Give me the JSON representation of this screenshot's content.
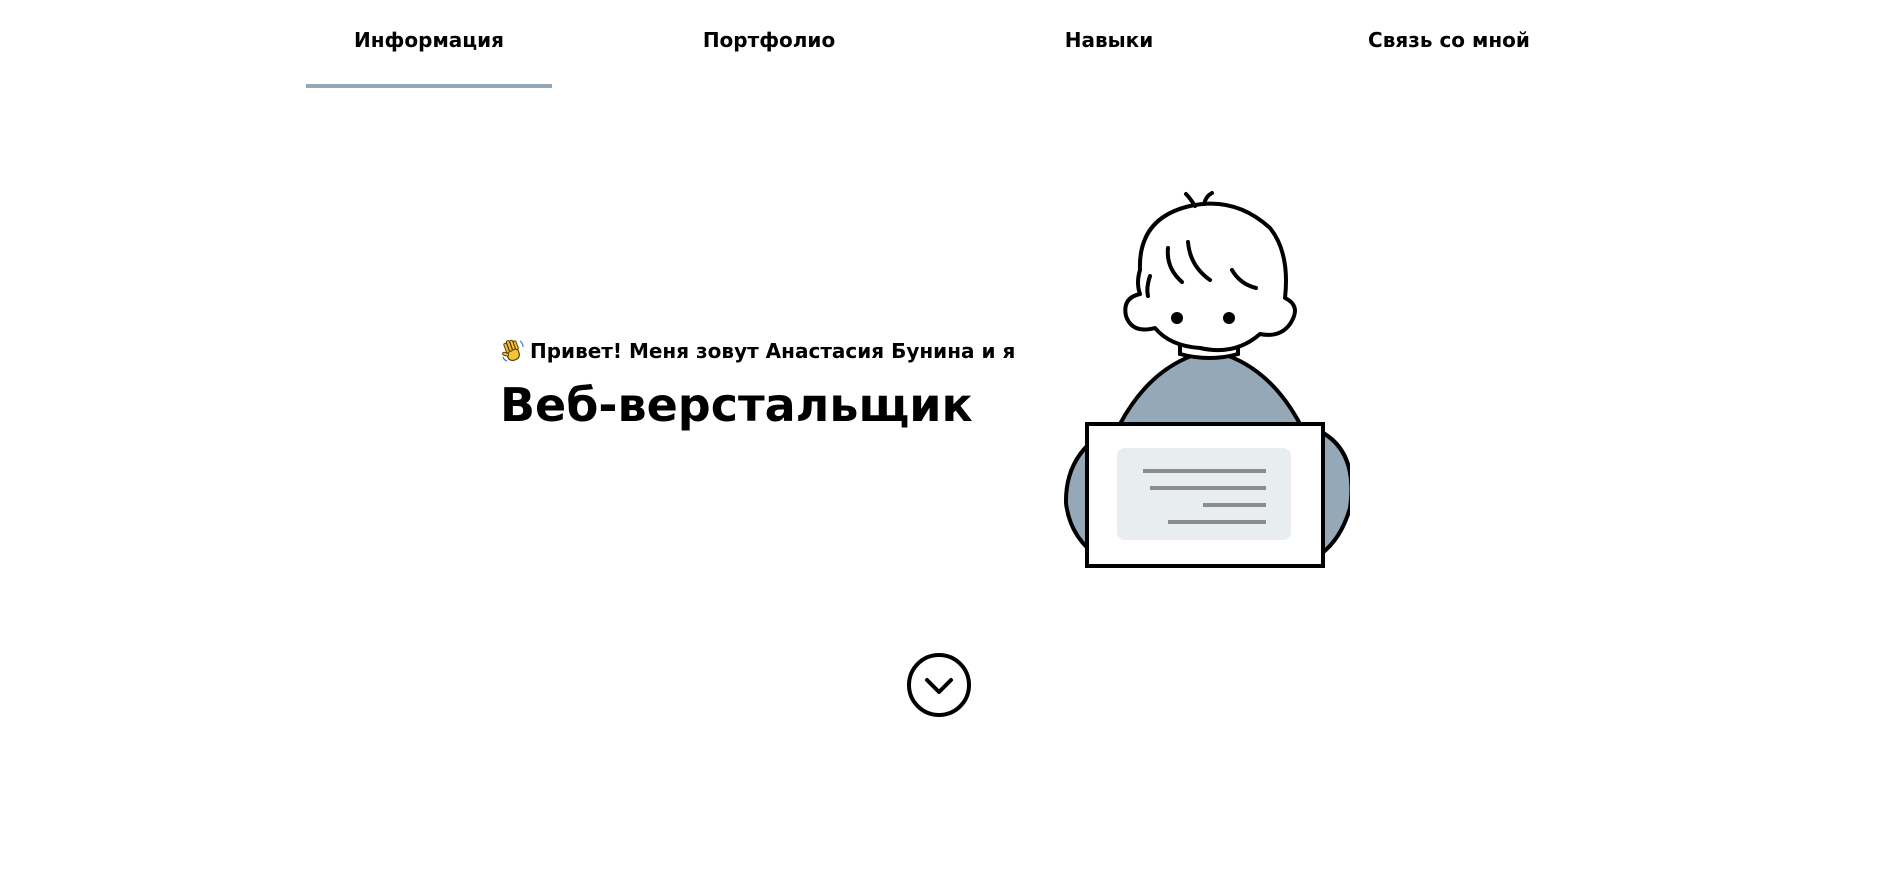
{
  "nav": {
    "tabs": [
      {
        "label": "Информация",
        "active": true
      },
      {
        "label": "Портфолио",
        "active": false
      },
      {
        "label": "Навыки",
        "active": false
      },
      {
        "label": "Связь со мной",
        "active": false
      }
    ],
    "active_indicator_color": "#94a8b8"
  },
  "hero": {
    "greeting": "Привет! Меня зовут Анастасия Бунина и я",
    "greeting_icon": "waving-hand-icon",
    "headline": "Веб-верстальщик",
    "illustration": "person-holding-laptop-illustration"
  },
  "scroll_button": {
    "icon": "chevron-down-circle-icon"
  },
  "colors": {
    "sweater": "#94a8b8",
    "screen": "#e8edf0",
    "screen_lines": "#8c8c8c",
    "outline": "#000000"
  }
}
